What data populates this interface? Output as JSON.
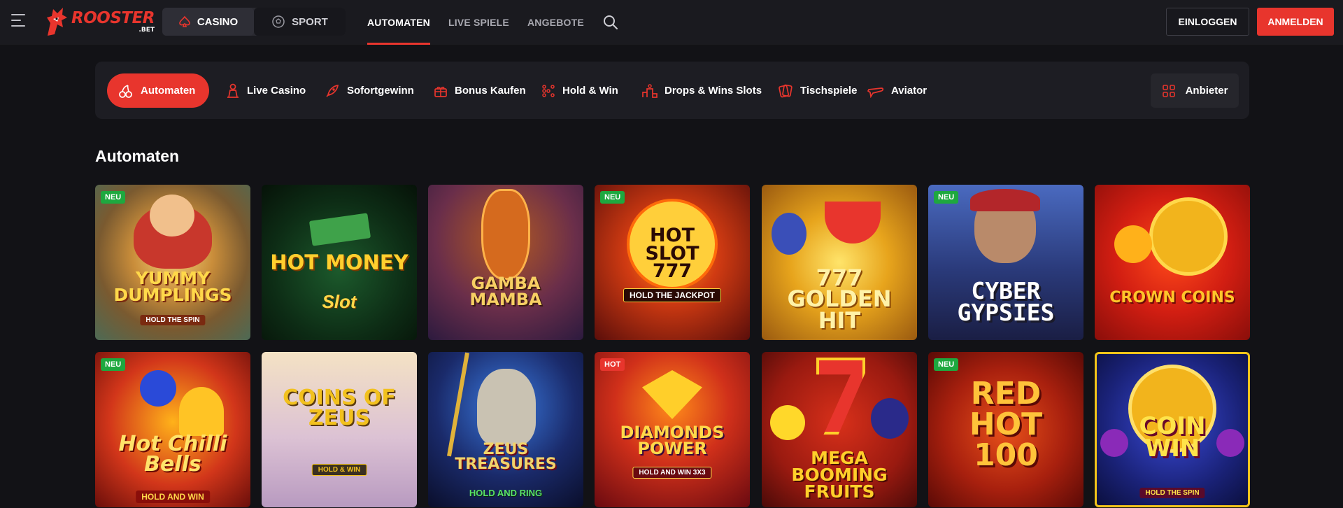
{
  "header": {
    "logo": {
      "main": "ROOSTER",
      "sub": ".BET"
    },
    "switch": [
      {
        "label": "CASINO",
        "icon": "spade-icon"
      },
      {
        "label": "SPORT",
        "icon": "soccer-ball-icon"
      }
    ],
    "nav": [
      "AUTOMATEN",
      "LIVE SPIELE",
      "ANGEBOTE"
    ],
    "login_label": "EINLOGGEN",
    "register_label": "ANMELDEN"
  },
  "categories": [
    {
      "label": "Automaten",
      "icon": "cherries-icon"
    },
    {
      "label": "Live Casino",
      "icon": "dealer-icon"
    },
    {
      "label": "Sofortgewinn",
      "icon": "rocket-icon"
    },
    {
      "label": "Bonus Kaufen",
      "icon": "gift-icon"
    },
    {
      "label": "Hold & Win",
      "icon": "dots-grid-icon"
    },
    {
      "label": "Drops & Wins Slots",
      "icon": "podium-icon"
    },
    {
      "label": "Tischspiele",
      "icon": "cards-icon"
    },
    {
      "label": "Aviator",
      "icon": "plane-icon"
    }
  ],
  "provider_label": "Anbieter",
  "section_title": "Automaten",
  "games": [
    {
      "title": "YUMMY DUMPLINGS",
      "subtitle": "HOLD THE SPIN",
      "badge": "NEU"
    },
    {
      "title": "HOT MONEY",
      "subtitle": "Slot",
      "badge": ""
    },
    {
      "title": "GAMBA MAMBA",
      "subtitle": "",
      "badge": ""
    },
    {
      "title": "HOT SLOT 777",
      "subtitle": "HOLD THE JACKPOT",
      "badge": "NEU"
    },
    {
      "title": "777 GOLDEN HIT",
      "subtitle": "",
      "badge": ""
    },
    {
      "title": "CYBER GYPSIES",
      "subtitle": "",
      "badge": "NEU"
    },
    {
      "title": "CROWN COINS",
      "subtitle": "",
      "badge": ""
    },
    {
      "title": "Hot Chilli Bells",
      "subtitle": "HOLD AND WIN",
      "badge": "NEU"
    },
    {
      "title": "COINS OF ZEUS",
      "subtitle": "HOLD & WIN",
      "badge": ""
    },
    {
      "title": "ZEUS TREASURES",
      "subtitle": "HOLD AND RING",
      "badge": ""
    },
    {
      "title": "DIAMONDS POWER",
      "subtitle": "HOLD AND WIN 3X3",
      "badge": "HOT"
    },
    {
      "title": "MEGA BOOMING FRUITS",
      "subtitle": "",
      "badge": ""
    },
    {
      "title": "RED HOT 100",
      "subtitle": "",
      "badge": "NEU"
    },
    {
      "title": "COIN WIN",
      "subtitle": "HOLD THE SPIN",
      "badge": ""
    }
  ],
  "colors": {
    "accent": "#e8352d",
    "background": "#121216",
    "new_badge": "#1ea83f",
    "selected_border": "#f2c41a"
  }
}
